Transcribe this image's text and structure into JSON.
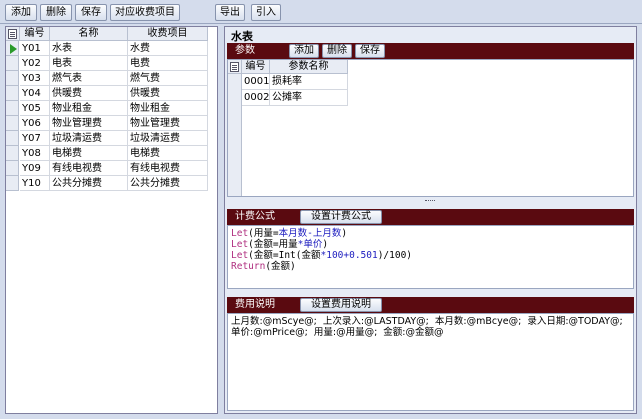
{
  "toolbar": {
    "add": "添加",
    "delete": "删除",
    "save": "保存",
    "match_fee": "对应收费项目",
    "export": "导出",
    "import": "引入"
  },
  "left_grid": {
    "headers": [
      "编号",
      "名称",
      "收费项目"
    ],
    "rows": [
      {
        "code": "Y01",
        "name": "水表",
        "fee": "水费"
      },
      {
        "code": "Y02",
        "name": "电表",
        "fee": "电费"
      },
      {
        "code": "Y03",
        "name": "燃气表",
        "fee": "燃气费"
      },
      {
        "code": "Y04",
        "name": "供暖费",
        "fee": "供暖费"
      },
      {
        "code": "Y05",
        "name": "物业租金",
        "fee": "物业租金"
      },
      {
        "code": "Y06",
        "name": "物业管理费",
        "fee": "物业管理费"
      },
      {
        "code": "Y07",
        "name": "垃圾清运费",
        "fee": "垃圾清运费"
      },
      {
        "code": "Y08",
        "name": "电梯费",
        "fee": "电梯费"
      },
      {
        "code": "Y09",
        "name": "有线电视费",
        "fee": "有线电视费"
      },
      {
        "code": "Y10",
        "name": "公共分摊费",
        "fee": "公共分摊费"
      }
    ]
  },
  "right": {
    "title": "水表",
    "params": {
      "header": "参数",
      "add": "添加",
      "delete": "删除",
      "save": "保存",
      "grid_headers": [
        "编号",
        "参数名称"
      ],
      "rows": [
        {
          "code": "0001",
          "name": "损耗率"
        },
        {
          "code": "0002",
          "name": "公摊率"
        }
      ]
    },
    "formula": {
      "header": "计费公式",
      "button": "设置计费公式",
      "lines": [
        {
          "kw": "Let",
          "a": "(用量=",
          "b": "本月数-上月数",
          "c": ")"
        },
        {
          "kw": "Let",
          "a": "(金额=用量",
          "b": "*单价",
          "c": ")"
        },
        {
          "kw": "Let",
          "a": "(金额=Int(金额",
          "b": "*100+0.501",
          "c": ")/100)"
        },
        {
          "kw": "Return",
          "a": "(金额)",
          "b": "",
          "c": ""
        }
      ]
    },
    "fee_note": {
      "header": "费用说明",
      "button": "设置费用说明",
      "line1": "上月数:@mScye@;  上次录入:@LASTDAY@;  本月数:@mBcye@;  录入日期:@TODAY@;",
      "line2": "单价:@mPrice@;  用量:@用量@;  金额:@金额@"
    }
  }
}
